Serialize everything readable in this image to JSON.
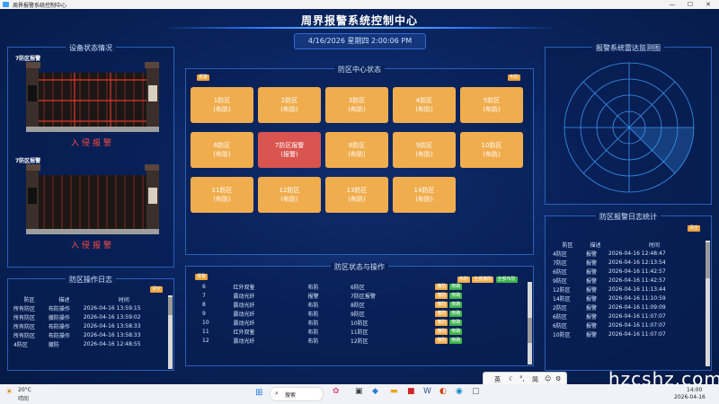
{
  "window": {
    "title": "周界报警系统控制中心"
  },
  "header": {
    "title": "周界报警系统控制中心",
    "datetime": "4/16/2026 星期四 2:00:06 PM"
  },
  "device_panel": {
    "title": "设备状态情况",
    "devices": [
      {
        "label": "7防区报警",
        "status": "入侵报警"
      },
      {
        "label": "7防区报警",
        "status": "入侵报警"
      }
    ]
  },
  "center_panel": {
    "title": "防区中心状态",
    "tag_left": "报警",
    "tag_right": "布防",
    "zones": [
      {
        "name": "1防区",
        "state": "(布防)",
        "alarm": false
      },
      {
        "name": "2防区",
        "state": "(布防)",
        "alarm": false
      },
      {
        "name": "3防区",
        "state": "(布防)",
        "alarm": false
      },
      {
        "name": "4防区",
        "state": "(布防)",
        "alarm": false
      },
      {
        "name": "5防区",
        "state": "(布防)",
        "alarm": false
      },
      {
        "name": "6防区",
        "state": "(布防)",
        "alarm": false
      },
      {
        "name": "7防区报警",
        "state": "(报警)",
        "alarm": true
      },
      {
        "name": "8防区",
        "state": "(布防)",
        "alarm": false
      },
      {
        "name": "9防区",
        "state": "(布防)",
        "alarm": false
      },
      {
        "name": "10防区",
        "state": "(布防)",
        "alarm": false
      },
      {
        "name": "11防区",
        "state": "(布防)",
        "alarm": false
      },
      {
        "name": "12防区",
        "state": "(布防)",
        "alarm": false
      },
      {
        "name": "13防区",
        "state": "(布防)",
        "alarm": false
      },
      {
        "name": "14防区",
        "state": "(布防)",
        "alarm": false
      }
    ]
  },
  "radar_panel": {
    "title": "报警系统雷达监测图"
  },
  "oplog_panel": {
    "title": "防区操作日志",
    "tag": "清空",
    "columns": [
      "防区",
      "描述",
      "时间"
    ],
    "rows": [
      [
        "所有防区",
        "布防操作",
        "2026-04-16 13:59:15"
      ],
      [
        "所有防区",
        "撤防操作",
        "2026-04-16 13:59:02"
      ],
      [
        "所有防区",
        "布防操作",
        "2026-04-16 13:58:33"
      ],
      [
        "所有防区",
        "布防操作",
        "2026-04-16 13:58:33"
      ],
      [
        "4防区",
        "撤防",
        "2026-04-16 12:48:55"
      ]
    ]
  },
  "zone_ops_panel": {
    "title": "防区状态与操作",
    "tag_left": "报警",
    "top_buttons": [
      "布防",
      "全部撤防",
      "全部布防"
    ],
    "rows": [
      {
        "id": "6",
        "type": "红外双鉴",
        "state": "布防",
        "name": "6防区",
        "btn1": "撤防",
        "btn2": "旁路"
      },
      {
        "id": "7",
        "type": "震动光纤",
        "state": "报警",
        "name": "7防区报警",
        "btn1": "撤防",
        "btn2": "旁路"
      },
      {
        "id": "8",
        "type": "震动光纤",
        "state": "布防",
        "name": "8防区",
        "btn1": "撤防",
        "btn2": "旁路"
      },
      {
        "id": "9",
        "type": "震动光纤",
        "state": "布防",
        "name": "9防区",
        "btn1": "撤防",
        "btn2": "旁路"
      },
      {
        "id": "10",
        "type": "震动光纤",
        "state": "布防",
        "name": "10防区",
        "btn1": "撤防",
        "btn2": "旁路"
      },
      {
        "id": "11",
        "type": "红外双鉴",
        "state": "布防",
        "name": "11防区",
        "btn1": "撤防",
        "btn2": "旁路"
      },
      {
        "id": "12",
        "type": "震动光纤",
        "state": "布防",
        "name": "12防区",
        "btn1": "撤防",
        "btn2": "旁路"
      }
    ]
  },
  "alarm_log_panel": {
    "title": "防区报警日志统计",
    "tag": "清空",
    "columns": [
      "防区",
      "描述",
      "时间"
    ],
    "rows": [
      [
        "4防区",
        "报警",
        "2026-04-16 12:48:47"
      ],
      [
        "7防区",
        "报警",
        "2026-04-16 12:13:54"
      ],
      [
        "6防区",
        "报警",
        "2026-04-16 11:42:57"
      ],
      [
        "9防区",
        "报警",
        "2026-04-16 11:42:57"
      ],
      [
        "12防区",
        "报警",
        "2026-04-16 11:13:44"
      ],
      [
        "14防区",
        "报警",
        "2026-04-16 11:10:59"
      ],
      [
        "2防区",
        "报警",
        "2026-04-16 11:09:09"
      ],
      [
        "6防区",
        "报警",
        "2026-04-16 11:07:07"
      ],
      [
        "6防区",
        "报警",
        "2026-04-16 11:07:07"
      ],
      [
        "10防区",
        "报警",
        "2026-04-16 11:07:07"
      ]
    ]
  },
  "taskbar": {
    "weather": "20°C",
    "weather_sub": "晴朗",
    "search": "搜索",
    "ime": [
      "英",
      "简"
    ],
    "clock_time": "14:00",
    "clock_date": "2026-04-16"
  },
  "watermark": "hzcshz.com",
  "colors": {
    "zone_normal": "#f0ad4e",
    "zone_alarm": "#d9534f",
    "accent": "#2e7dff"
  }
}
